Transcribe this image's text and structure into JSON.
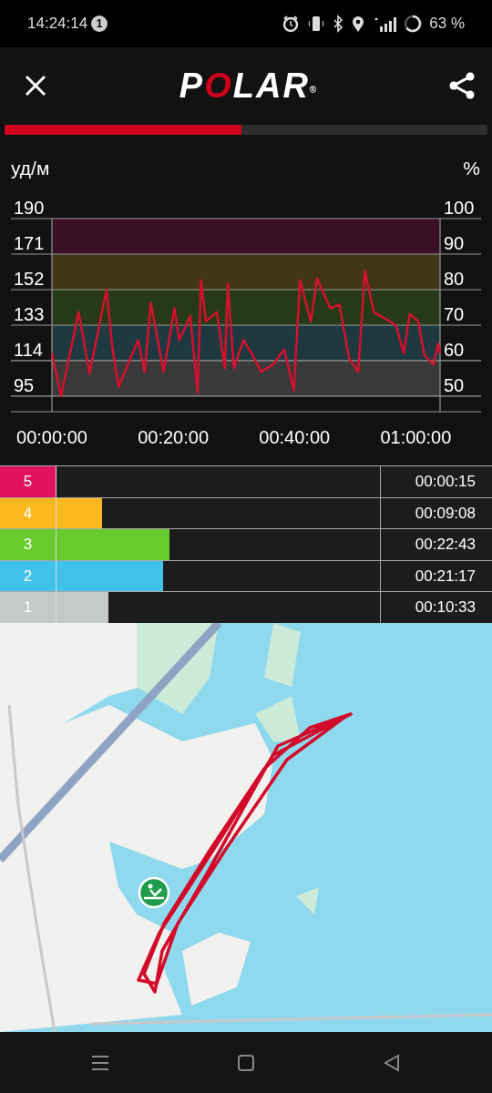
{
  "status_bar": {
    "time": "14:24:14",
    "notification_count": "1",
    "battery": "63 %"
  },
  "app_bar": {
    "logo": "POLAR",
    "logo_mark": "®"
  },
  "progress": {
    "level": 0.49
  },
  "hr_chart": {
    "right_axis": {
      "title": "%",
      "ticks": [
        "100",
        "90",
        "80",
        "70",
        "60",
        "50"
      ]
    },
    "chart_data": {
      "type": "line",
      "ylabel": "уд/м",
      "xlim": [
        0,
        64
      ],
      "ylim": [
        86.7,
        190
      ],
      "grid": true,
      "bands": [
        {
          "axis": "y",
          "from": 95,
          "to": 114,
          "color": "#393939"
        },
        {
          "axis": "y",
          "from": 114,
          "to": 133,
          "color": "#1e3840"
        },
        {
          "axis": "y",
          "from": 133,
          "to": 152,
          "color": "#263a1a"
        },
        {
          "axis": "y",
          "from": 152,
          "to": 171,
          "color": "#433617"
        },
        {
          "axis": "y",
          "from": 171,
          "to": 190,
          "color": "#3a1024"
        }
      ],
      "yticks": [
        95,
        114,
        133,
        152,
        171,
        190
      ],
      "xticks": [
        {
          "value": 0,
          "label": "00:00:00"
        },
        {
          "value": 20,
          "label": "00:20:00"
        },
        {
          "value": 40,
          "label": "00:40:00"
        },
        {
          "value": 60,
          "label": "01:00:00"
        }
      ],
      "x": [
        0,
        1.5,
        4.4,
        6.2,
        9,
        10,
        11,
        14.2,
        15.3,
        16.3,
        18.4,
        20.2,
        21,
        22.8,
        24,
        24.6,
        25.4,
        27.2,
        28.5,
        29,
        30,
        31.6,
        32.9,
        34.5,
        36.5,
        38.3,
        39.9,
        40.9,
        42.7,
        43.7,
        45.9,
        47.4,
        49,
        50.5,
        51.6,
        53.1,
        54.7,
        56.7,
        58,
        59,
        60.4,
        61.4,
        62.9,
        63.7,
        64
      ],
      "series": [
        {
          "color": "#d5102d",
          "values": [
            118,
            95,
            140,
            107,
            152,
            120,
            100,
            125,
            108,
            145,
            108,
            142,
            125,
            138,
            97,
            157,
            135,
            140,
            110,
            155,
            110,
            125,
            118,
            108,
            112,
            120,
            98,
            157,
            135,
            158,
            142,
            144,
            115,
            108,
            162,
            140,
            137,
            133,
            118,
            139,
            135,
            117,
            112,
            123,
            118
          ]
        }
      ]
    }
  },
  "zones": [
    {
      "label": "5",
      "time": "00:00:15",
      "level": 0,
      "color": "#e0125e"
    },
    {
      "label": "4",
      "time": "00:09:08",
      "level": 0.14,
      "color": "#fbb91f"
    },
    {
      "label": "3",
      "time": "00:22:43",
      "level": 0.35,
      "color": "#68cb2d"
    },
    {
      "label": "2",
      "time": "00:21:17",
      "level": 0.33,
      "color": "#40c2eb"
    },
    {
      "label": "1",
      "time": "00:10:33",
      "level": 0.16,
      "color": "#c6c9c9"
    }
  ]
}
